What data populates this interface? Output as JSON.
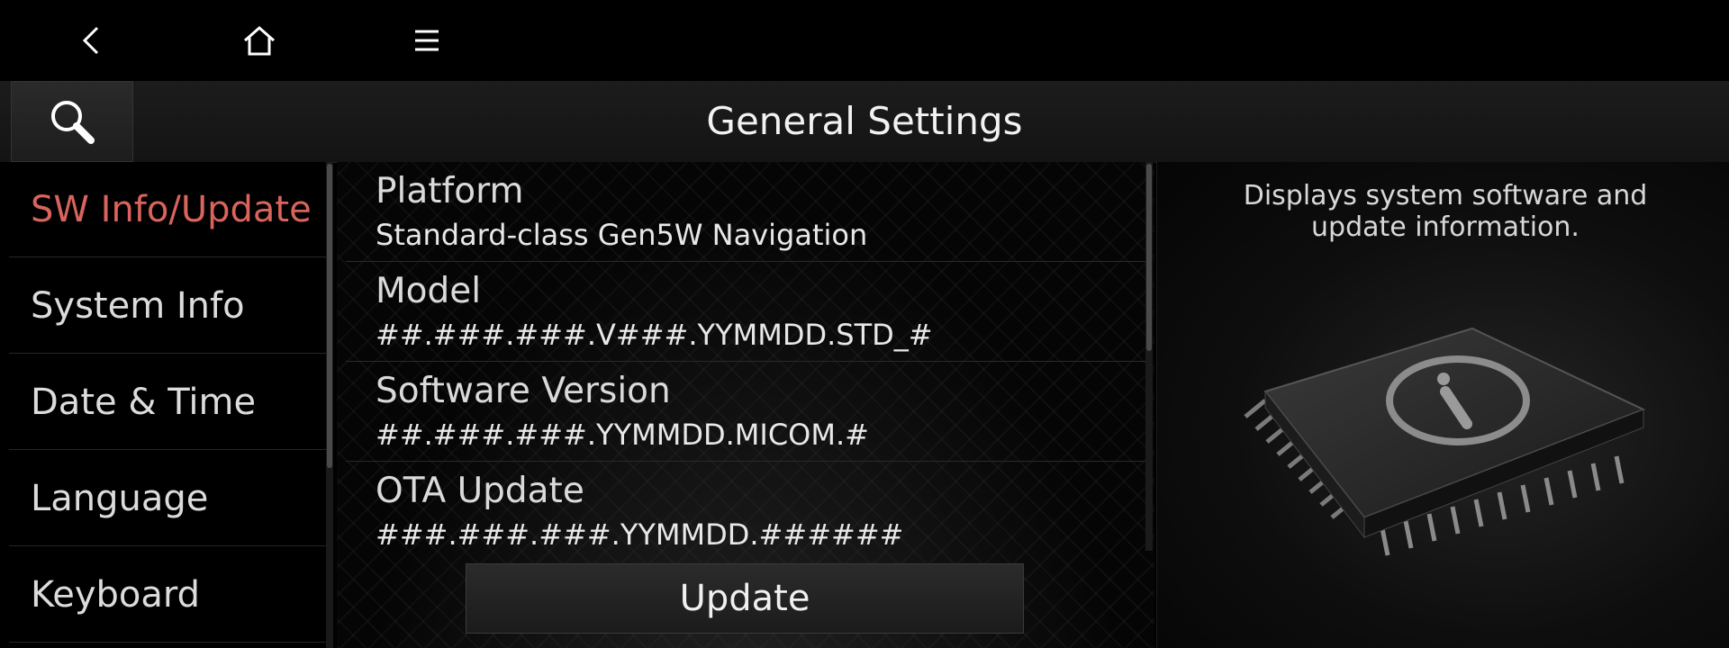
{
  "topbar": {
    "back_icon": "back-chevron-icon",
    "home_icon": "home-icon",
    "menu_icon": "menu-icon"
  },
  "header": {
    "title": "General Settings",
    "search_icon": "search-icon"
  },
  "sidebar": {
    "items": [
      {
        "label": "SW Info/Update",
        "active": true
      },
      {
        "label": "System Info",
        "active": false
      },
      {
        "label": "Date & Time",
        "active": false
      },
      {
        "label": "Language",
        "active": false
      },
      {
        "label": "Keyboard",
        "active": false
      }
    ]
  },
  "info": {
    "rows": [
      {
        "label": "Platform",
        "value": "Standard-class Gen5W Navigation"
      },
      {
        "label": "Model",
        "value": "##.###.###.V###.YYMMDD.STD_#"
      },
      {
        "label": "Software Version",
        "value": "##.###.###.YYMMDD.MICOM.#"
      },
      {
        "label": "OTA Update",
        "value": "###.###.###.YYMMDD.######"
      }
    ],
    "update_label": "Update"
  },
  "help": {
    "description": "Displays system software and update information.",
    "illustration_icon": "chip-info-icon"
  },
  "colors": {
    "accent": "#d9645d",
    "background": "#000000"
  }
}
